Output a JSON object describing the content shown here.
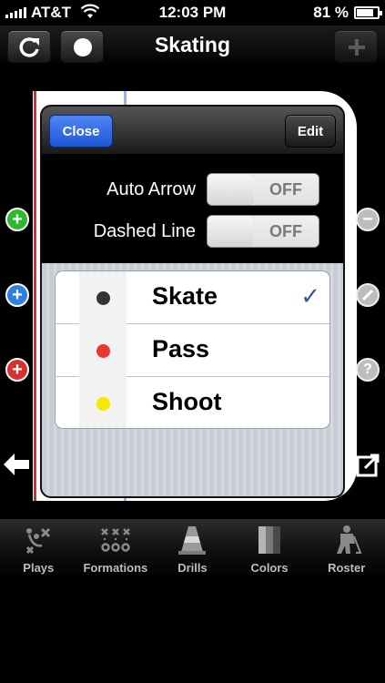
{
  "status_bar": {
    "carrier": "AT&T",
    "time": "12:03 PM",
    "battery_percent": "81 %",
    "battery_level": 0.81
  },
  "navbar": {
    "title": "Skating"
  },
  "popover": {
    "close_label": "Close",
    "edit_label": "Edit",
    "toggles": [
      {
        "label": "Auto Arrow",
        "state": "OFF"
      },
      {
        "label": "Dashed Line",
        "state": "OFF"
      }
    ],
    "line_types": [
      {
        "label": "Skate",
        "color": "#333333",
        "selected": true,
        "check": "✓"
      },
      {
        "label": "Pass",
        "color": "#e53935",
        "selected": false,
        "check": ""
      },
      {
        "label": "Shoot",
        "color": "#f5e900",
        "selected": false,
        "check": ""
      }
    ]
  },
  "colors": {
    "add_green": "#2eb82e",
    "add_blue": "#2f7fe0",
    "add_red": "#d83030"
  },
  "tabs": [
    {
      "label": "Plays",
      "icon": "plays-icon"
    },
    {
      "label": "Formations",
      "icon": "formations-icon"
    },
    {
      "label": "Drills",
      "icon": "drills-cone-icon"
    },
    {
      "label": "Colors",
      "icon": "colors-icon"
    },
    {
      "label": "Roster",
      "icon": "roster-player-icon"
    }
  ]
}
